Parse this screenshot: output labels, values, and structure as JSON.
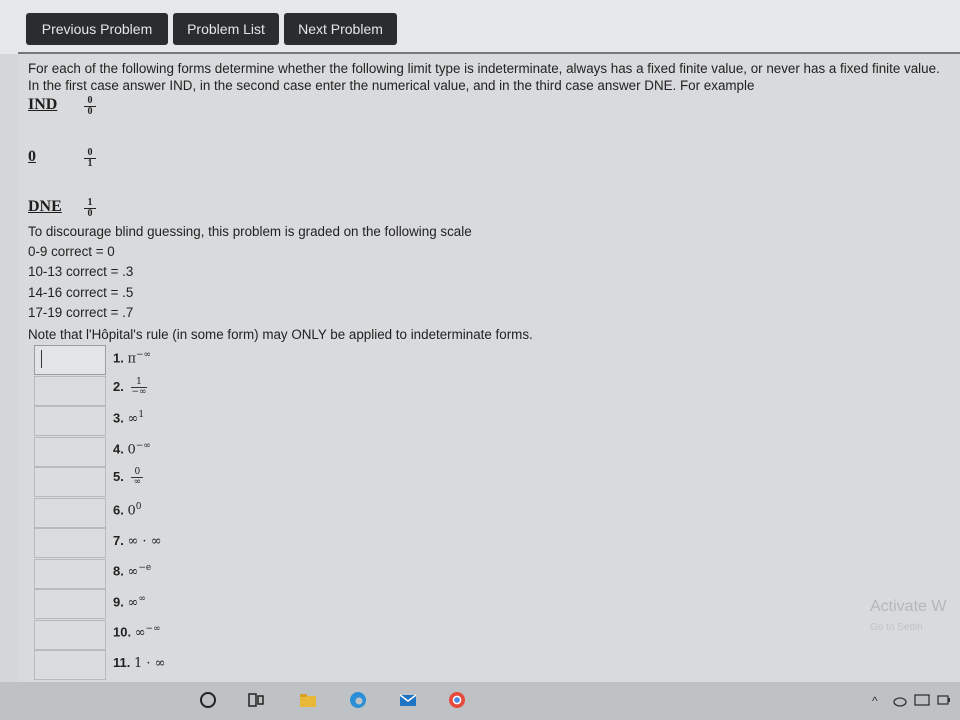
{
  "nav": {
    "prev": "Previous Problem",
    "list": "Problem List",
    "next": "Next Problem"
  },
  "intro": "For each of the following forms determine whether the following limit type is indeterminate, always has a fixed finite value, or never has a fixed finite value. In the first case answer IND, in the second case enter the numerical value, and in the third case answer DNE. For example",
  "examples": [
    {
      "word": "IND",
      "num": "0",
      "den": "0"
    },
    {
      "word": "0",
      "num": "0",
      "den": "1"
    },
    {
      "word": "DNE",
      "num": "1",
      "den": "0"
    }
  ],
  "scale_intro": "To discourage blind guessing, this problem is graded on the following scale",
  "scale": [
    "0-9 correct = 0",
    "10-13 correct = .3",
    "14-16 correct = .5",
    "17-19 correct = .7"
  ],
  "note": "Note that l'Hôpital's rule (in some form) may ONLY be applied to indeterminate forms.",
  "problems": [
    {
      "n": "1.",
      "base": "π",
      "exp": "−∞"
    },
    {
      "n": "2.",
      "frac_num": "1",
      "frac_den": "−∞"
    },
    {
      "n": "3.",
      "base": "∞",
      "exp": "1"
    },
    {
      "n": "4.",
      "base": "0",
      "exp": "−∞"
    },
    {
      "n": "5.",
      "frac_num": "0",
      "frac_den": "∞"
    },
    {
      "n": "6.",
      "base": "0",
      "exp": "0"
    },
    {
      "n": "7.",
      "base": "∞ · ∞",
      "exp": ""
    },
    {
      "n": "8.",
      "base": "∞",
      "exp": "−e"
    },
    {
      "n": "9.",
      "base": "∞",
      "exp": "∞"
    },
    {
      "n": "10.",
      "base": "∞",
      "exp": "−∞"
    },
    {
      "n": "11.",
      "base": "1 · ∞",
      "exp": ""
    }
  ],
  "watermark": {
    "line1": "Activate W",
    "line2": "Go to Settin"
  }
}
